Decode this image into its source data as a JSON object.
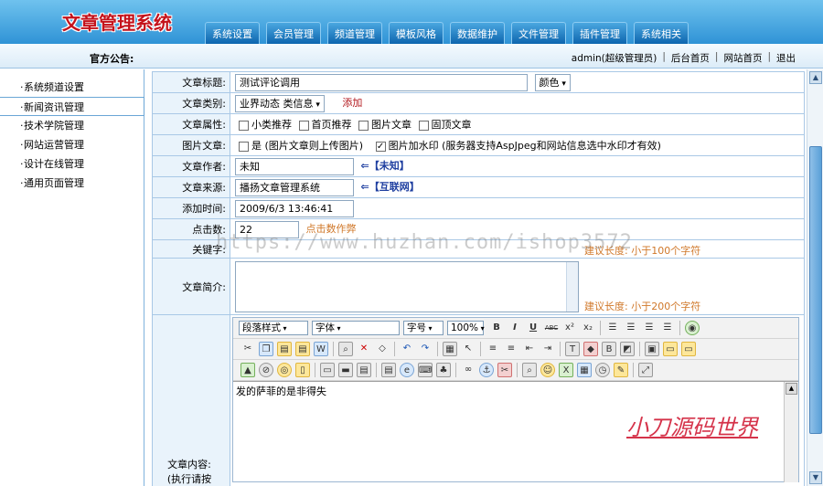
{
  "app": {
    "title": "文章管理系统"
  },
  "nav": {
    "tabs": [
      "系统设置",
      "会员管理",
      "频道管理",
      "模板风格",
      "数据维护",
      "文件管理",
      "插件管理",
      "系统相关"
    ]
  },
  "notice": {
    "label": "官方公告:"
  },
  "userbar": {
    "user": "admin(超级管理员)",
    "links": [
      "后台首页",
      "网站首页",
      "退出"
    ]
  },
  "sidebar": {
    "items": [
      "系统频道设置",
      "新闻资讯管理",
      "技术学院管理",
      "网站运营管理",
      "设计在线管理",
      "通用页面管理"
    ],
    "active_index": 1
  },
  "form": {
    "title": {
      "label": "文章标题:",
      "value": "测试评论调用",
      "color_select": "颜色"
    },
    "category": {
      "label": "文章类别:",
      "value": "业界动态 类信息",
      "add_link": "添加"
    },
    "attributes": {
      "label": "文章属性:",
      "options": [
        "小类推荐",
        "首页推荐",
        "图片文章",
        "固顶文章"
      ]
    },
    "image": {
      "label": "图片文章:",
      "option1": "是 (图片文章则上传图片)",
      "option2": "图片加水印 (服务器支持AspJpeg和网站信息选中水印才有效)",
      "option2_checked": true
    },
    "author": {
      "label": "文章作者:",
      "value": "未知",
      "quick": "⇐【未知】"
    },
    "source": {
      "label": "文章来源:",
      "value": "播扬文章管理系统",
      "quick": "⇐【互联网】"
    },
    "time": {
      "label": "添加时间:",
      "value": "2009/6/3 13:46:41"
    },
    "hits": {
      "label": "点击数:",
      "value": "22",
      "hint": "点击数作弊"
    },
    "keywords": {
      "label": "关键字:",
      "hint": "建议长度: 小于100个字符"
    },
    "summary": {
      "label": "文章简介:",
      "hint": "建议长度: 小于200个字符"
    },
    "content": {
      "label": "文章内容:",
      "label2": "(执行请按",
      "text": "发的萨菲的是非得失"
    }
  },
  "editor": {
    "row1": {
      "format": "段落样式",
      "font": "字体",
      "size": "字号",
      "zoom": "100%"
    },
    "brand": "小刀源码世界"
  },
  "watermark": "https://www.huzhan.com/ishop3572"
}
